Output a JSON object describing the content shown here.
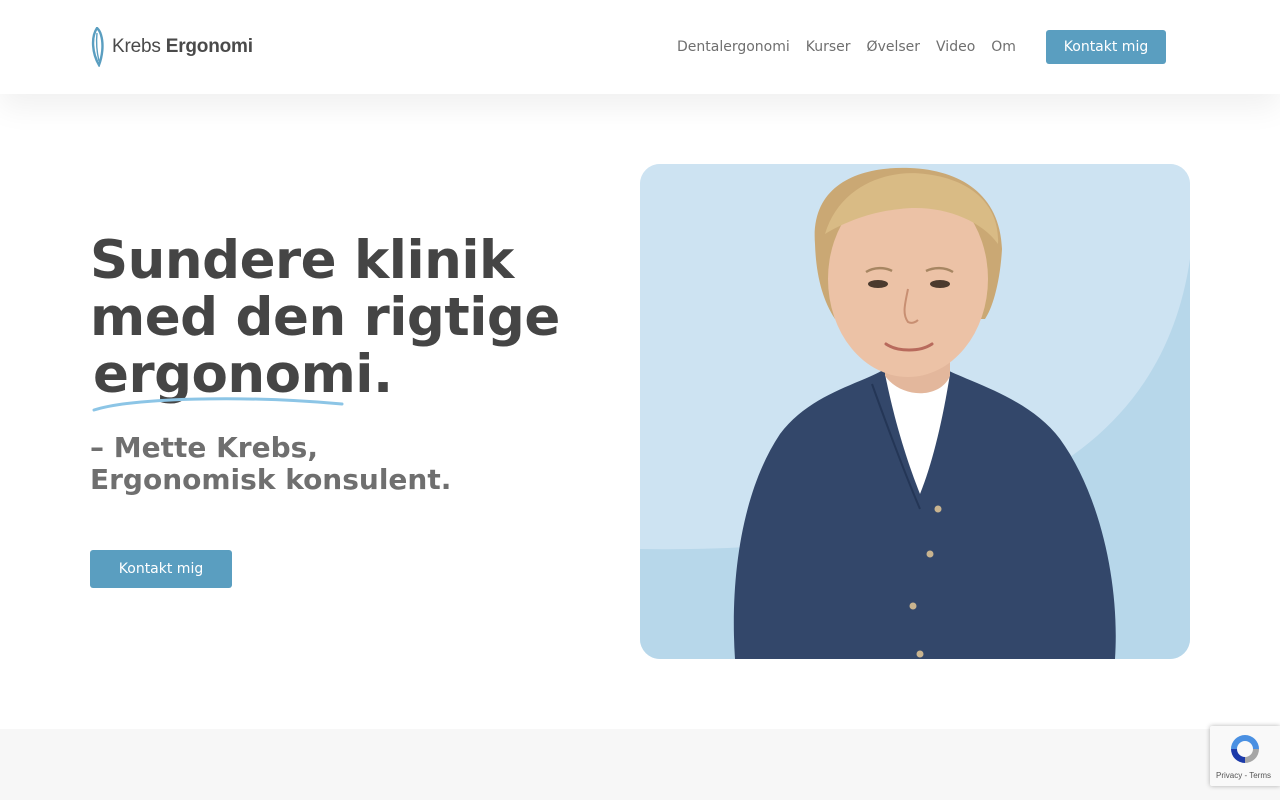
{
  "brand": {
    "name_regular": "Krebs ",
    "name_bold": "Ergonomi",
    "color": "#5a9ec0"
  },
  "nav": {
    "items": [
      "Dentalergonomi",
      "Kurser",
      "Øvelser",
      "Video",
      "Om"
    ],
    "cta": "Kontakt mig"
  },
  "hero": {
    "title_line1": "Sundere klinik",
    "title_line2": "med den rigtige",
    "title_highlight": "ergonomi.",
    "subtitle": "– Mette Krebs, Ergonomisk konsulent.",
    "cta": "Kontakt mig",
    "photo": "portrait-of-mette-krebs",
    "photo_background": "#cde3f2"
  },
  "recaptcha": {
    "privacy": "Privacy",
    "separator": " - ",
    "terms": "Terms"
  }
}
